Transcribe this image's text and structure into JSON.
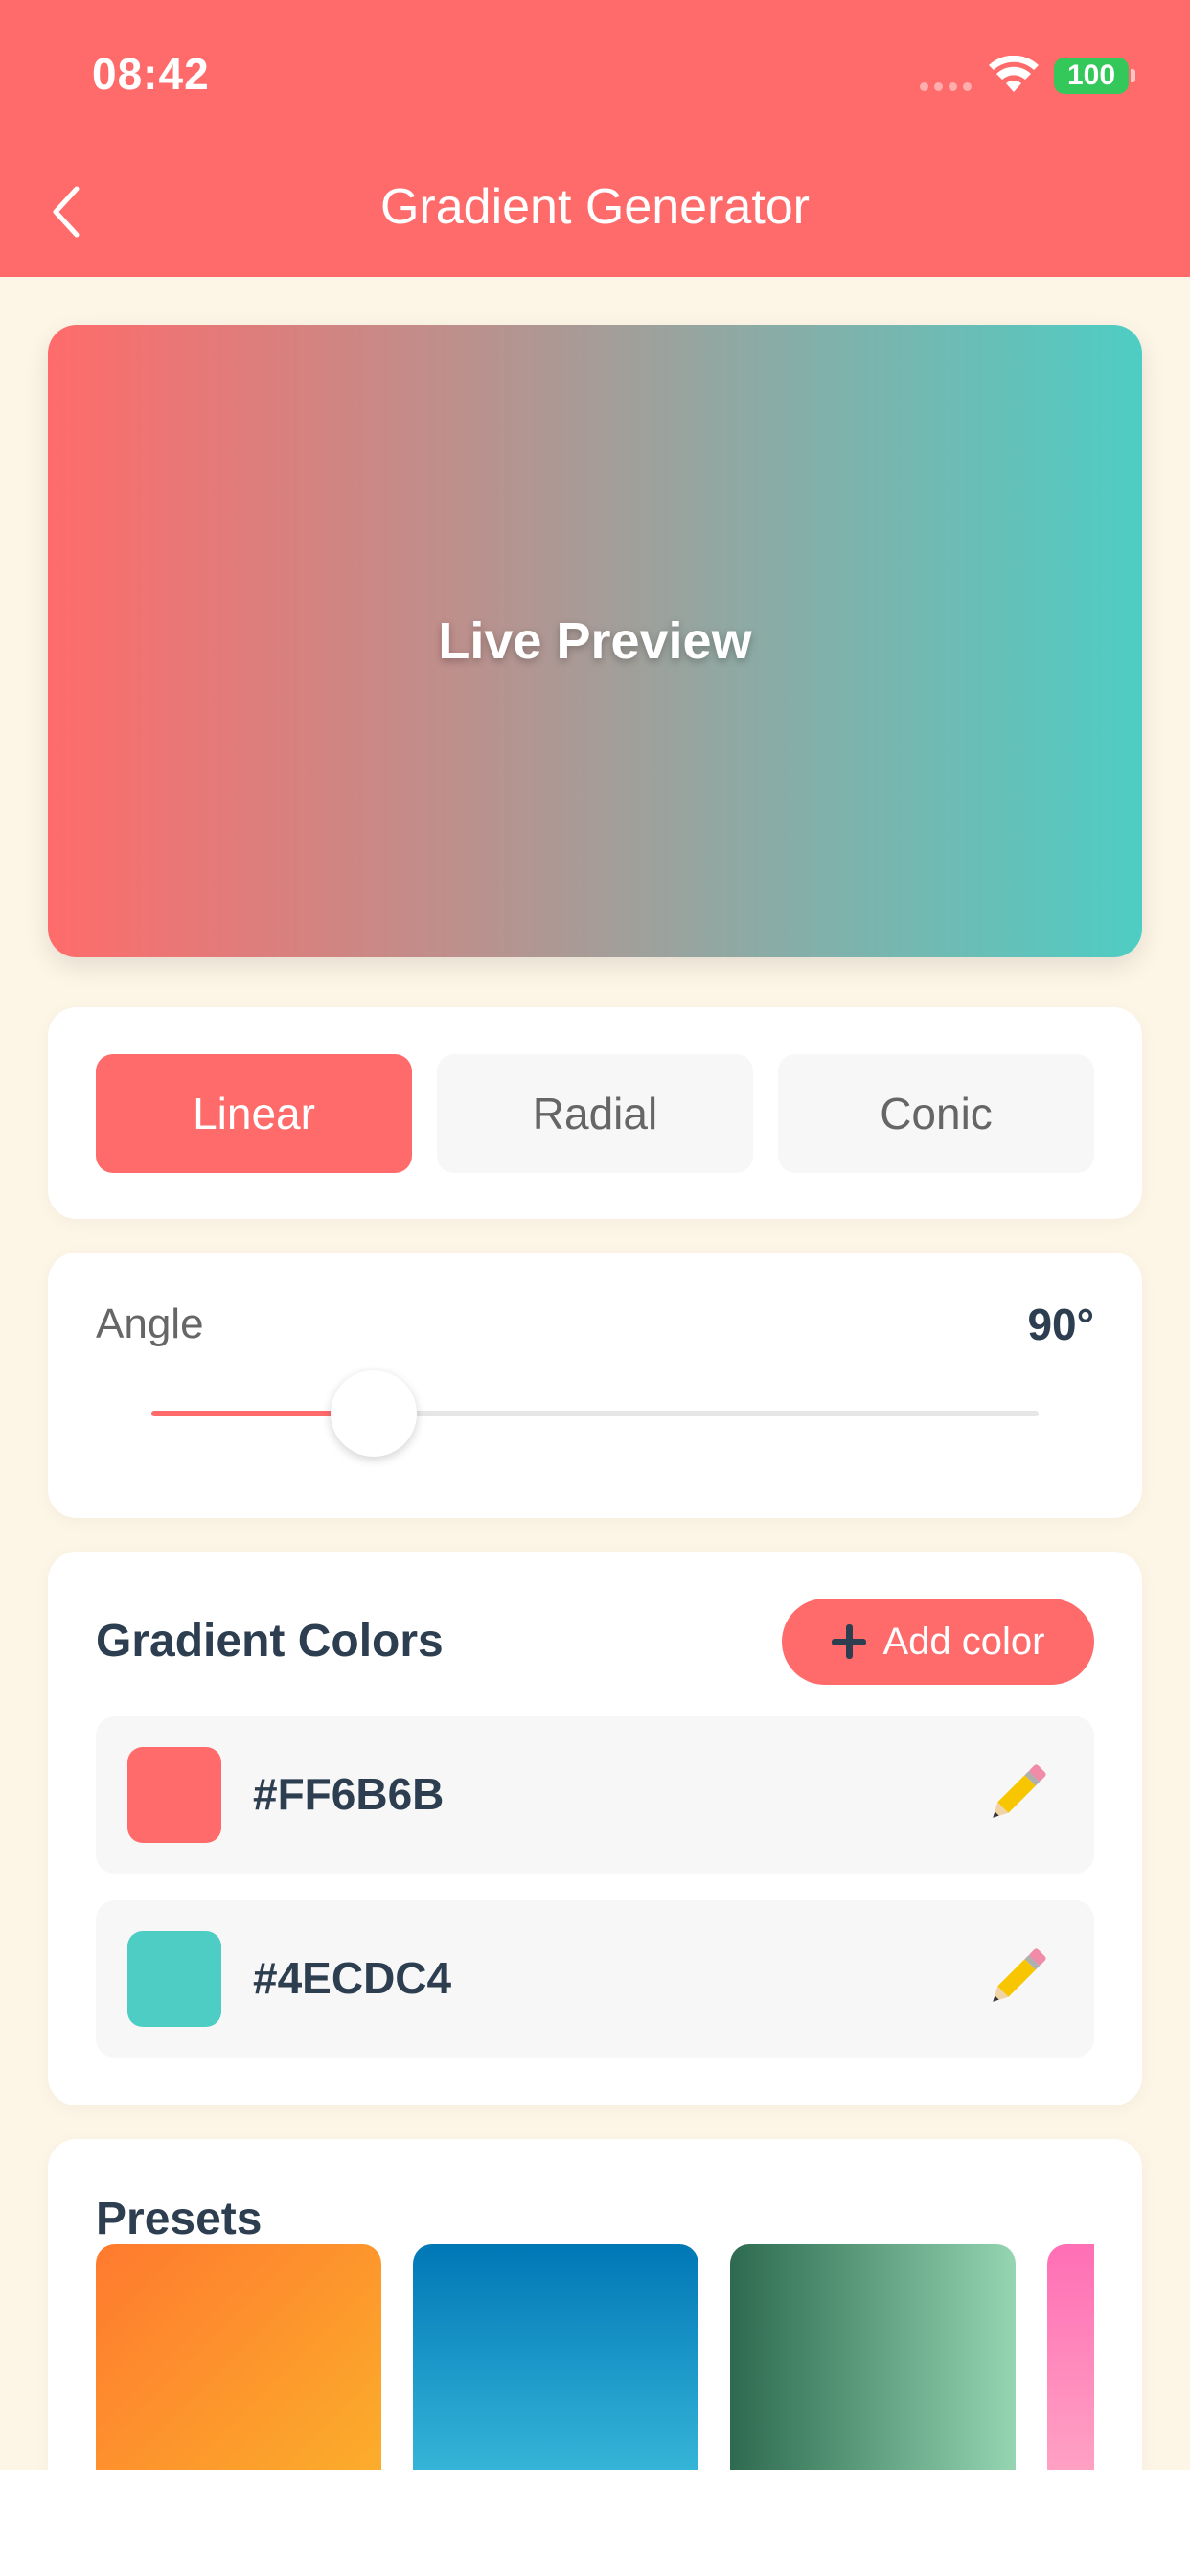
{
  "status_bar": {
    "time": "08:42",
    "battery": "100"
  },
  "header": {
    "title": "Gradient Generator"
  },
  "preview": {
    "label": "Live Preview"
  },
  "gradient_types": [
    {
      "label": "Linear",
      "active": true
    },
    {
      "label": "Radial",
      "active": false
    },
    {
      "label": "Conic",
      "active": false
    }
  ],
  "angle": {
    "label": "Angle",
    "value_text": "90°",
    "value": 90,
    "max": 360
  },
  "gradient_colors": {
    "title": "Gradient Colors",
    "add_label": "Add color",
    "items": [
      {
        "hex": "#FF6B6B"
      },
      {
        "hex": "#4ECDC4"
      }
    ]
  },
  "presets": {
    "title": "Presets",
    "items": [
      {
        "from": "#FF7A2F",
        "to": "#FBB52A"
      },
      {
        "from": "#0077B6",
        "to": "#48CAE4"
      },
      {
        "from": "#2D6A4F",
        "to": "#95D5B2"
      },
      {
        "from": "#FF6FB5",
        "to": "#FFB3C8"
      }
    ]
  },
  "colors": {
    "accent": "#FF6B6B",
    "background": "#FDF5E6",
    "text_dark": "#2C3E50"
  }
}
